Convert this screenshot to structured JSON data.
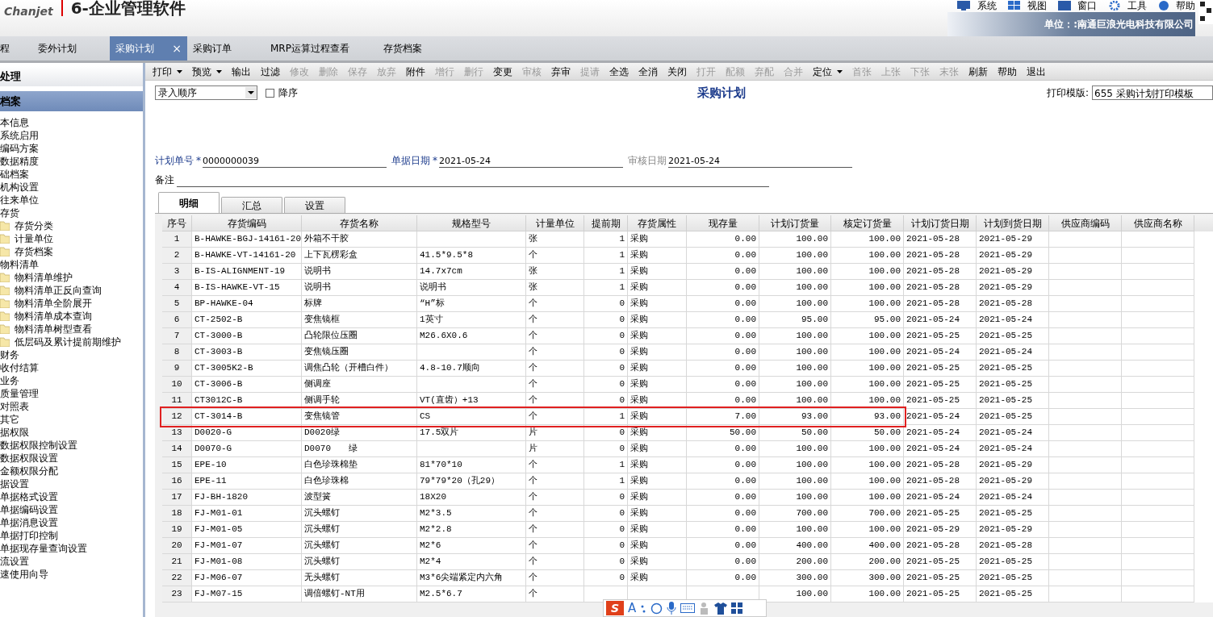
{
  "header": {
    "logo": "Chanjet",
    "product": "6-企业管理软件",
    "menu": [
      {
        "label": "系统",
        "kind": "monitor"
      },
      {
        "label": "视图",
        "kind": "windows"
      },
      {
        "label": "窗口",
        "kind": "window"
      },
      {
        "label": "工具",
        "kind": "gear"
      },
      {
        "label": "帮助",
        "kind": "help"
      }
    ],
    "unit": "单位：:南通巨浪光电科技有限公司"
  },
  "tabs": [
    {
      "label": "程",
      "selected": false
    },
    {
      "label": "委外计划",
      "selected": false
    },
    {
      "label": "采购计划",
      "selected": true,
      "close": "×"
    },
    {
      "label": "采购订单",
      "selected": false
    },
    {
      "label": "MRP运算过程查看",
      "selected": false
    },
    {
      "label": "存货档案",
      "selected": false
    }
  ],
  "sidebar": {
    "sections": [
      {
        "label": "处理",
        "selected": false
      },
      {
        "label": "档案",
        "selected": true
      }
    ],
    "items": [
      {
        "label": "本信息"
      },
      {
        "label": "系统启用"
      },
      {
        "label": "编码方案"
      },
      {
        "label": "数据精度"
      },
      {
        "label": "础档案"
      },
      {
        "label": "机构设置"
      },
      {
        "label": "往来单位"
      },
      {
        "label": "存货",
        "children": [
          {
            "label": "存货分类"
          },
          {
            "label": "计量单位"
          },
          {
            "label": "存货档案"
          }
        ]
      },
      {
        "label": "物料清单",
        "children": [
          {
            "label": "物料清单维护"
          },
          {
            "label": "物料清单正反向查询"
          },
          {
            "label": "物料清单全阶展开"
          },
          {
            "label": "物料清单成本查询"
          },
          {
            "label": "物料清单树型查看"
          },
          {
            "label": "低层码及累计提前期维护"
          }
        ]
      },
      {
        "label": "财务"
      },
      {
        "label": "收付结算"
      },
      {
        "label": "业务"
      },
      {
        "label": "质量管理"
      },
      {
        "label": "对照表"
      },
      {
        "label": "其它"
      },
      {
        "label": "据权限"
      },
      {
        "label": "数据权限控制设置"
      },
      {
        "label": "数据权限设置"
      },
      {
        "label": "金额权限分配"
      },
      {
        "label": "据设置"
      },
      {
        "label": "单据格式设置"
      },
      {
        "label": "单据编码设置"
      },
      {
        "label": "单据消息设置"
      },
      {
        "label": "单据打印控制"
      },
      {
        "label": "单据现存量查询设置"
      },
      {
        "label": "流设置"
      },
      {
        "label": "速使用向导"
      }
    ]
  },
  "toolbar": [
    {
      "label": "打印",
      "disabled": false,
      "dropdown": true
    },
    {
      "label": "预览",
      "disabled": false,
      "dropdown": true
    },
    {
      "label": "输出",
      "disabled": false,
      "dropdown": false
    },
    {
      "label": "过滤",
      "disabled": false,
      "dropdown": false
    },
    {
      "label": "修改",
      "disabled": true,
      "dropdown": false
    },
    {
      "label": "删除",
      "disabled": true,
      "dropdown": false
    },
    {
      "label": "保存",
      "disabled": true,
      "dropdown": false
    },
    {
      "label": "放弃",
      "disabled": true,
      "dropdown": false
    },
    {
      "label": "附件",
      "disabled": false,
      "dropdown": false
    },
    {
      "label": "增行",
      "disabled": true,
      "dropdown": false
    },
    {
      "label": "删行",
      "disabled": true,
      "dropdown": false
    },
    {
      "label": "变更",
      "disabled": false,
      "dropdown": false
    },
    {
      "label": "审核",
      "disabled": true,
      "dropdown": false
    },
    {
      "label": "弃审",
      "disabled": false,
      "dropdown": false
    },
    {
      "label": "提请",
      "disabled": true,
      "dropdown": false
    },
    {
      "label": "全选",
      "disabled": false,
      "dropdown": false
    },
    {
      "label": "全消",
      "disabled": false,
      "dropdown": false
    },
    {
      "label": "关闭",
      "disabled": false,
      "dropdown": false
    },
    {
      "label": "打开",
      "disabled": true,
      "dropdown": false
    },
    {
      "label": "配额",
      "disabled": true,
      "dropdown": false
    },
    {
      "label": "弃配",
      "disabled": true,
      "dropdown": false
    },
    {
      "label": "合并",
      "disabled": true,
      "dropdown": false
    },
    {
      "label": "定位",
      "disabled": false,
      "dropdown": true
    },
    {
      "label": "首张",
      "disabled": true,
      "dropdown": false
    },
    {
      "label": "上张",
      "disabled": true,
      "dropdown": false
    },
    {
      "label": "下张",
      "disabled": true,
      "dropdown": false
    },
    {
      "label": "末张",
      "disabled": true,
      "dropdown": false
    },
    {
      "label": "刷新",
      "disabled": false,
      "dropdown": false
    },
    {
      "label": "帮助",
      "disabled": false,
      "dropdown": false
    },
    {
      "label": "退出",
      "disabled": false,
      "dropdown": false
    }
  ],
  "form": {
    "sort": {
      "value": "录入顺序"
    },
    "descending": {
      "label": "降序",
      "checked": false
    },
    "title": "采购计划",
    "print_template": {
      "label": "打印模版:",
      "value": "655 采购计划打印模板"
    },
    "fields": [
      {
        "label": "计划单号",
        "required": true,
        "value": "0000000039"
      },
      {
        "label": "单据日期",
        "required": true,
        "value": "2021-05-24"
      },
      {
        "label": "审核日期",
        "required": false,
        "value": "2021-05-24"
      }
    ],
    "remark": {
      "label": "备注"
    },
    "required_mark": "*"
  },
  "subtabs": [
    {
      "label": "明细",
      "selected": true
    },
    {
      "label": "汇总",
      "selected": false
    },
    {
      "label": "设置",
      "selected": false
    }
  ],
  "table": {
    "columns": [
      "序号",
      "存货编码",
      "存货名称",
      "规格型号",
      "计量单位",
      "提前期",
      "存货属性",
      "现存量",
      "计划订货量",
      "核定订货量",
      "计划订货日期",
      "计划到货日期",
      "供应商编码",
      "供应商名称"
    ],
    "rows": [
      {
        "no": "1",
        "code": "B-HAWKE-BGJ-14161-20",
        "name": "外箱不干胶",
        "unit": "张",
        "lead": "1",
        "attr": "采购",
        "stock": "0.00",
        "plan": "100.00",
        "approved": "100.00",
        "order_date": "2021-05-28",
        "arrival_date": "2021-05-29",
        "highlighted": false
      },
      {
        "no": "2",
        "code": "B-HAWKE-VT-14161-20",
        "name": "上下瓦楞彩盒",
        "spec": "41.5*9.5*8",
        "unit": "个",
        "lead": "1",
        "attr": "采购",
        "stock": "0.00",
        "plan": "100.00",
        "approved": "100.00",
        "order_date": "2021-05-28",
        "arrival_date": "2021-05-29",
        "highlighted": false
      },
      {
        "no": "3",
        "code": "B-IS-ALIGNMENT-19",
        "name": "说明书",
        "spec": "14.7x7cm",
        "unit": "张",
        "lead": "1",
        "attr": "采购",
        "stock": "0.00",
        "plan": "100.00",
        "approved": "100.00",
        "order_date": "2021-05-28",
        "arrival_date": "2021-05-29",
        "highlighted": false
      },
      {
        "no": "4",
        "code": "B-IS-HAWKE-VT-15",
        "name": "说明书",
        "spec": "说明书",
        "unit": "张",
        "lead": "1",
        "attr": "采购",
        "stock": "0.00",
        "plan": "100.00",
        "approved": "100.00",
        "order_date": "2021-05-28",
        "arrival_date": "2021-05-29",
        "highlighted": false
      },
      {
        "no": "5",
        "code": "BP-HAWKE-04",
        "name": "标牌",
        "spec": "“H”标",
        "unit": "个",
        "lead": "0",
        "attr": "采购",
        "stock": "0.00",
        "plan": "100.00",
        "approved": "100.00",
        "order_date": "2021-05-28",
        "arrival_date": "2021-05-28",
        "highlighted": false
      },
      {
        "no": "6",
        "code": "CT-2502-B",
        "name": "变焦镜框",
        "spec": "1英寸",
        "unit": "个",
        "lead": "0",
        "attr": "采购",
        "stock": "0.00",
        "plan": "95.00",
        "approved": "95.00",
        "order_date": "2021-05-24",
        "arrival_date": "2021-05-24",
        "highlighted": false
      },
      {
        "no": "7",
        "code": "CT-3000-B",
        "name": "凸轮限位压圈",
        "spec": "M26.6X0.6",
        "unit": "个",
        "lead": "0",
        "attr": "采购",
        "stock": "0.00",
        "plan": "100.00",
        "approved": "100.00",
        "order_date": "2021-05-25",
        "arrival_date": "2021-05-25",
        "highlighted": false
      },
      {
        "no": "8",
        "code": "CT-3003-B",
        "name": "变焦镜压圈",
        "unit": "个",
        "lead": "0",
        "attr": "采购",
        "stock": "0.00",
        "plan": "100.00",
        "approved": "100.00",
        "order_date": "2021-05-24",
        "arrival_date": "2021-05-24",
        "highlighted": false
      },
      {
        "no": "9",
        "code": "CT-3005K2-B",
        "name": "调焦凸轮（开槽白件）",
        "spec": "4.8-10.7顺向",
        "unit": "个",
        "lead": "0",
        "attr": "采购",
        "stock": "0.00",
        "plan": "100.00",
        "approved": "100.00",
        "order_date": "2021-05-25",
        "arrival_date": "2021-05-25",
        "highlighted": false
      },
      {
        "no": "10",
        "code": "CT-3006-B",
        "name": "侧调座",
        "unit": "个",
        "lead": "0",
        "attr": "采购",
        "stock": "0.00",
        "plan": "100.00",
        "approved": "100.00",
        "order_date": "2021-05-25",
        "arrival_date": "2021-05-25",
        "highlighted": false
      },
      {
        "no": "11",
        "code": "CT3012C-B",
        "name": "侧调手轮",
        "spec": "VT(直齿）+13",
        "unit": "个",
        "lead": "0",
        "attr": "采购",
        "stock": "0.00",
        "plan": "100.00",
        "approved": "100.00",
        "order_date": "2021-05-25",
        "arrival_date": "2021-05-25",
        "highlighted": false
      },
      {
        "no": "12",
        "code": "CT-3014-B",
        "name": "变焦镜管",
        "spec": "CS",
        "unit": "个",
        "lead": "1",
        "attr": "采购",
        "stock": "7.00",
        "plan": "93.00",
        "approved": "93.00",
        "order_date": "2021-05-24",
        "arrival_date": "2021-05-25",
        "highlighted": true
      },
      {
        "no": "13",
        "code": "D0020-G",
        "name": "D0020绿",
        "spec": "17.5双片",
        "unit": "片",
        "lead": "0",
        "attr": "采购",
        "stock": "50.00",
        "plan": "50.00",
        "approved": "50.00",
        "order_date": "2021-05-24",
        "arrival_date": "2021-05-24",
        "highlighted": false
      },
      {
        "no": "14",
        "code": "D0070-G",
        "name": "D0070　　绿",
        "unit": "片",
        "lead": "0",
        "attr": "采购",
        "stock": "0.00",
        "plan": "100.00",
        "approved": "100.00",
        "order_date": "2021-05-24",
        "arrival_date": "2021-05-24",
        "highlighted": false
      },
      {
        "no": "15",
        "code": "EPE-10",
        "name": "白色珍珠棉垫",
        "spec": "81*70*10",
        "unit": "个",
        "lead": "1",
        "attr": "采购",
        "stock": "0.00",
        "plan": "100.00",
        "approved": "100.00",
        "order_date": "2021-05-28",
        "arrival_date": "2021-05-29",
        "highlighted": false
      },
      {
        "no": "16",
        "code": "EPE-11",
        "name": "白色珍珠棉",
        "spec": "79*79*20（孔29）",
        "unit": "个",
        "lead": "1",
        "attr": "采购",
        "stock": "0.00",
        "plan": "100.00",
        "approved": "100.00",
        "order_date": "2021-05-28",
        "arrival_date": "2021-05-29",
        "highlighted": false
      },
      {
        "no": "17",
        "code": "FJ-BH-1820",
        "name": "波型簧",
        "spec": "18X20",
        "unit": "个",
        "lead": "0",
        "attr": "采购",
        "stock": "0.00",
        "plan": "100.00",
        "approved": "100.00",
        "order_date": "2021-05-24",
        "arrival_date": "2021-05-24",
        "highlighted": false
      },
      {
        "no": "18",
        "code": "FJ-M01-01",
        "name": "沉头螺钉",
        "spec": "M2*3.5",
        "unit": "个",
        "lead": "0",
        "attr": "采购",
        "stock": "0.00",
        "plan": "700.00",
        "approved": "700.00",
        "order_date": "2021-05-25",
        "arrival_date": "2021-05-25",
        "highlighted": false
      },
      {
        "no": "19",
        "code": "FJ-M01-05",
        "name": "沉头螺钉",
        "spec": "M2*2.8",
        "unit": "个",
        "lead": "0",
        "attr": "采购",
        "stock": "0.00",
        "plan": "100.00",
        "approved": "100.00",
        "order_date": "2021-05-29",
        "arrival_date": "2021-05-29",
        "highlighted": false
      },
      {
        "no": "20",
        "code": "FJ-M01-07",
        "name": "沉头螺钉",
        "spec": "M2*6",
        "unit": "个",
        "lead": "0",
        "attr": "采购",
        "stock": "0.00",
        "plan": "400.00",
        "approved": "400.00",
        "order_date": "2021-05-28",
        "arrival_date": "2021-05-28",
        "highlighted": false
      },
      {
        "no": "21",
        "code": "FJ-M01-08",
        "name": "沉头螺钉",
        "spec": "M2*4",
        "unit": "个",
        "lead": "0",
        "attr": "采购",
        "stock": "0.00",
        "plan": "200.00",
        "approved": "200.00",
        "order_date": "2021-05-25",
        "arrival_date": "2021-05-25",
        "highlighted": false
      },
      {
        "no": "22",
        "code": "FJ-M06-07",
        "name": "无头螺钉",
        "spec": "M3*6尖端紧定内六角",
        "unit": "个",
        "lead": "0",
        "attr": "采购",
        "stock": "0.00",
        "plan": "300.00",
        "approved": "300.00",
        "order_date": "2021-05-25",
        "arrival_date": "2021-05-25",
        "highlighted": false
      },
      {
        "no": "23",
        "code": "FJ-M07-15",
        "name": "调倍螺钉-NT用",
        "spec": "M2.5*6.7",
        "unit": "个",
        "plan": "100.00",
        "approved": "100.00",
        "order_date": "2021-05-25",
        "arrival_date": "2021-05-25",
        "highlighted": false
      }
    ]
  },
  "ime_toolbar": {
    "logo": "S",
    "mode": "A"
  }
}
